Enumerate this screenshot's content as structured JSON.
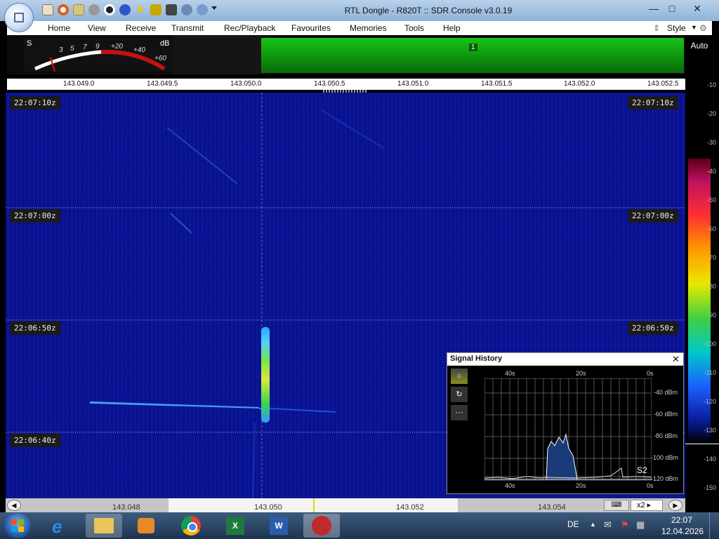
{
  "window": {
    "title": "RTL Dongle - R820T :: SDR Console v3.0.19"
  },
  "menu": {
    "items": [
      "Home",
      "View",
      "Receive",
      "Transmit",
      "Rec/Playback",
      "Favourites",
      "Memories",
      "Tools",
      "Help"
    ],
    "style_label": "Style"
  },
  "smeter": {
    "s_label": "S",
    "db_label": "dB",
    "scale": [
      "3",
      "5",
      "7",
      "9",
      "+20",
      "+40",
      "+60"
    ]
  },
  "band": {
    "marker": "1"
  },
  "auto_label": "Auto",
  "freq_axis": [
    "143.049.0",
    "143.049.5",
    "143.050.0",
    "143.050.5",
    "143.051.0",
    "143.051.5",
    "143.052.0",
    "143.052.5"
  ],
  "timestamps": [
    "22:07:10z",
    "22:07:00z",
    "22:06:50z",
    "22:06:40z"
  ],
  "db_scale": [
    "-10",
    "-20",
    "-30",
    "-40",
    "-50",
    "-60",
    "-70",
    "-80",
    "-90",
    "-100",
    "-110",
    "-120",
    "-130",
    "-140",
    "-150"
  ],
  "signal_history": {
    "title": "Signal History",
    "time_top": [
      "40s",
      "20s",
      "0s"
    ],
    "time_bottom": [
      "40s",
      "20s",
      "0s"
    ],
    "levels": [
      "-40 dBm",
      "-60 dBm",
      "-80 dBm",
      "-100 dBm",
      "-120 dBm"
    ],
    "s_reading": "S2",
    "buttons": [
      "○",
      "↻",
      "···"
    ]
  },
  "bottom_scroll": {
    "labels": [
      "143.048",
      "143.050",
      "143.052",
      "143.054"
    ],
    "zoom": "x2"
  },
  "taskbar": {
    "language": "DE",
    "time": "22:07",
    "date": "12.04.2026"
  },
  "colors": {
    "waterfall_bg": "#09128a",
    "band_green": "#16c016",
    "signal_yellow": "#d8e83a"
  }
}
